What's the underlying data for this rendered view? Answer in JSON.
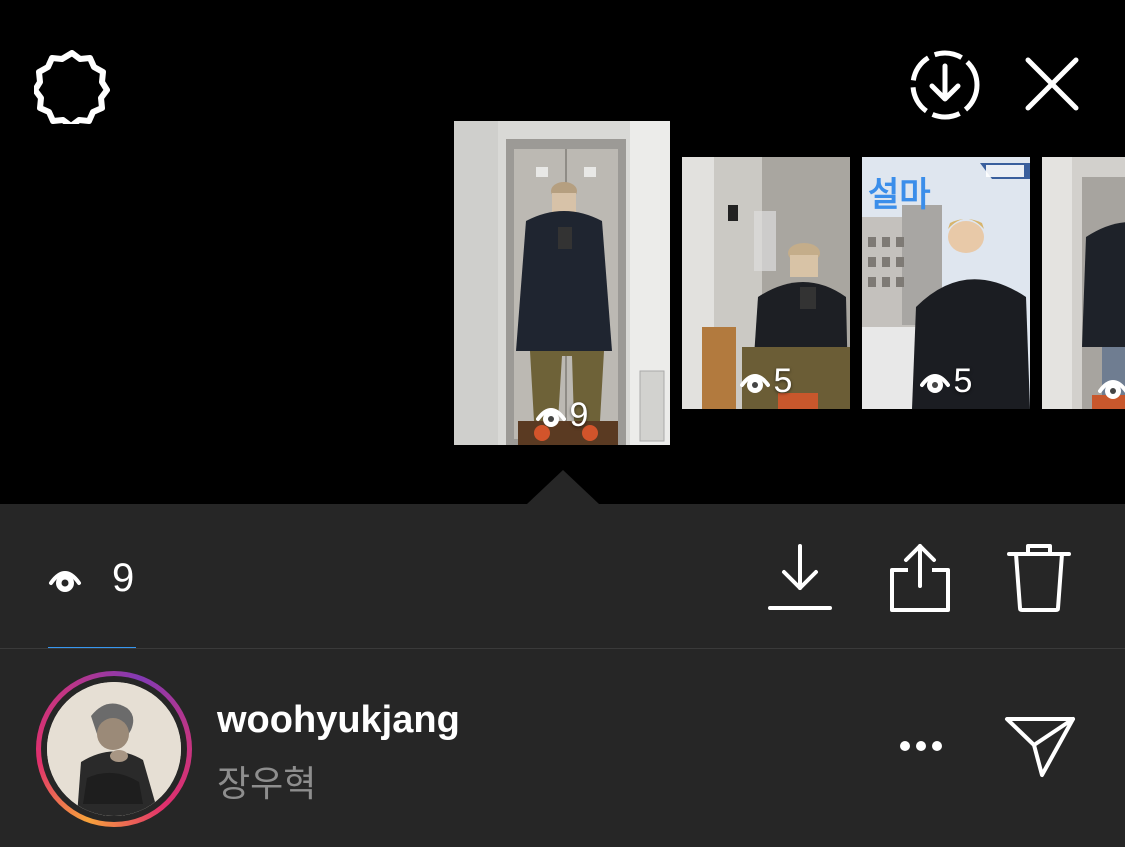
{
  "top_bar": {
    "settings_icon": "gear-icon",
    "download_all_icon": "circle-download-icon",
    "close_icon": "close-icon"
  },
  "story_thumbnails": [
    {
      "views": "9",
      "selected": true,
      "caption": ""
    },
    {
      "views": "5",
      "selected": false,
      "caption": ""
    },
    {
      "views": "5",
      "selected": false,
      "caption": "설마"
    },
    {
      "views": "",
      "selected": false,
      "caption": ""
    }
  ],
  "panel": {
    "viewer_count": "9",
    "eye_icon": "eye-icon",
    "actions": [
      {
        "icon": "download-icon"
      },
      {
        "icon": "share-icon"
      },
      {
        "icon": "trash-icon"
      }
    ]
  },
  "viewer": {
    "username": "woohyukjang",
    "full_name": "장우혁",
    "more_icon": "more-icon",
    "send_icon": "send-icon"
  },
  "colors": {
    "background": "#000000",
    "panel": "#262626",
    "accent": "#3797f0",
    "caption": "#3b8eea"
  }
}
